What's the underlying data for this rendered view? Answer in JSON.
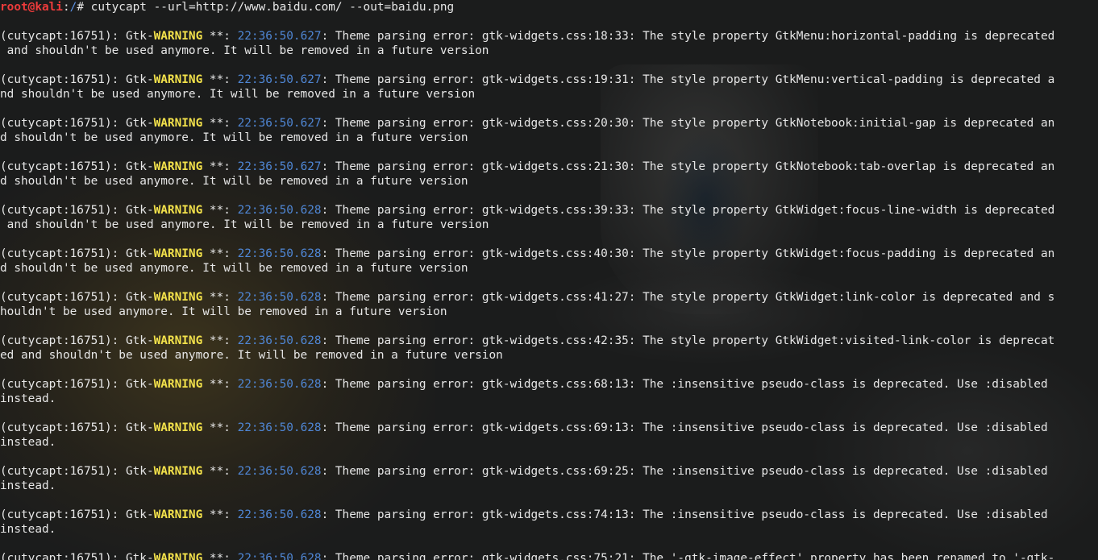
{
  "prompt": {
    "user_host": "root@kali",
    "separator": ":",
    "path": "/",
    "symbol": "# ",
    "command": "cutycapt --url=http://www.baidu.com/ --out=baidu.png"
  },
  "log": {
    "source": "(cutycapt:16751): Gtk-",
    "level": "WARNING",
    "stars": " **: ",
    "entries": [
      {
        "ts": "22:36:50.627",
        "msg": ": Theme parsing error: gtk-widgets.css:18:33: The style property GtkMenu:horizontal-padding is deprecated",
        "cont": " and shouldn't be used anymore. It will be removed in a future version"
      },
      {
        "ts": "22:36:50.627",
        "msg": ": Theme parsing error: gtk-widgets.css:19:31: The style property GtkMenu:vertical-padding is deprecated a",
        "cont": "nd shouldn't be used anymore. It will be removed in a future version"
      },
      {
        "ts": "22:36:50.627",
        "msg": ": Theme parsing error: gtk-widgets.css:20:30: The style property GtkNotebook:initial-gap is deprecated an",
        "cont": "d shouldn't be used anymore. It will be removed in a future version"
      },
      {
        "ts": "22:36:50.627",
        "msg": ": Theme parsing error: gtk-widgets.css:21:30: The style property GtkNotebook:tab-overlap is deprecated an",
        "cont": "d shouldn't be used anymore. It will be removed in a future version"
      },
      {
        "ts": "22:36:50.628",
        "msg": ": Theme parsing error: gtk-widgets.css:39:33: The style property GtkWidget:focus-line-width is deprecated",
        "cont": " and shouldn't be used anymore. It will be removed in a future version"
      },
      {
        "ts": "22:36:50.628",
        "msg": ": Theme parsing error: gtk-widgets.css:40:30: The style property GtkWidget:focus-padding is deprecated an",
        "cont": "d shouldn't be used anymore. It will be removed in a future version"
      },
      {
        "ts": "22:36:50.628",
        "msg": ": Theme parsing error: gtk-widgets.css:41:27: The style property GtkWidget:link-color is deprecated and s",
        "cont": "houldn't be used anymore. It will be removed in a future version"
      },
      {
        "ts": "22:36:50.628",
        "msg": ": Theme parsing error: gtk-widgets.css:42:35: The style property GtkWidget:visited-link-color is deprecat",
        "cont": "ed and shouldn't be used anymore. It will be removed in a future version"
      },
      {
        "ts": "22:36:50.628",
        "msg": ": Theme parsing error: gtk-widgets.css:68:13: The :insensitive pseudo-class is deprecated. Use :disabled",
        "cont": "instead."
      },
      {
        "ts": "22:36:50.628",
        "msg": ": Theme parsing error: gtk-widgets.css:69:13: The :insensitive pseudo-class is deprecated. Use :disabled",
        "cont": "instead."
      },
      {
        "ts": "22:36:50.628",
        "msg": ": Theme parsing error: gtk-widgets.css:69:25: The :insensitive pseudo-class is deprecated. Use :disabled",
        "cont": "instead."
      },
      {
        "ts": "22:36:50.628",
        "msg": ": Theme parsing error: gtk-widgets.css:74:13: The :insensitive pseudo-class is deprecated. Use :disabled",
        "cont": "instead."
      },
      {
        "ts": "22:36:50.628",
        "msg": ": Theme parsing error: gtk-widgets.css:75:21: The '-gtk-image-effect' property has been renamed to '-gtk-",
        "cont": ""
      }
    ]
  }
}
